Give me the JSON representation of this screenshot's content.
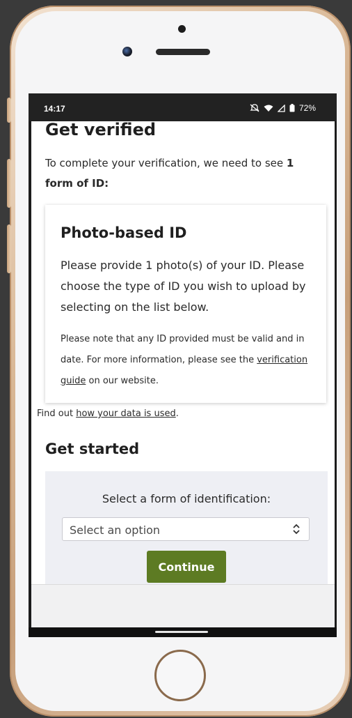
{
  "status_bar": {
    "time": "14:17",
    "battery": "72%",
    "icons": [
      "mute-icon",
      "wifi-icon",
      "signal-icon",
      "battery-icon"
    ]
  },
  "page": {
    "title": "Get verified",
    "intro_prefix": "To complete your verification, we need to see ",
    "intro_bold": "1 form of ID:"
  },
  "card": {
    "title": "Photo-based ID",
    "body": "Please provide 1 photo(s) of your ID. Please choose the type of ID you wish to upload by selecting on the list below.",
    "note_prefix": "Please note that any ID provided must be valid and in date. For more information, please see the ",
    "note_link": "verification guide",
    "note_suffix": " on our website."
  },
  "data_use": {
    "prefix": "Find out ",
    "link": "how your data is used",
    "suffix": "."
  },
  "get_started": {
    "title": "Get started",
    "select_label": "Select a form of identification:",
    "select_value": "Select an option",
    "continue_label": "Continue"
  },
  "colors": {
    "accent": "#5d7b23",
    "panel": "#eeeff4",
    "frame": "#d9b896"
  }
}
